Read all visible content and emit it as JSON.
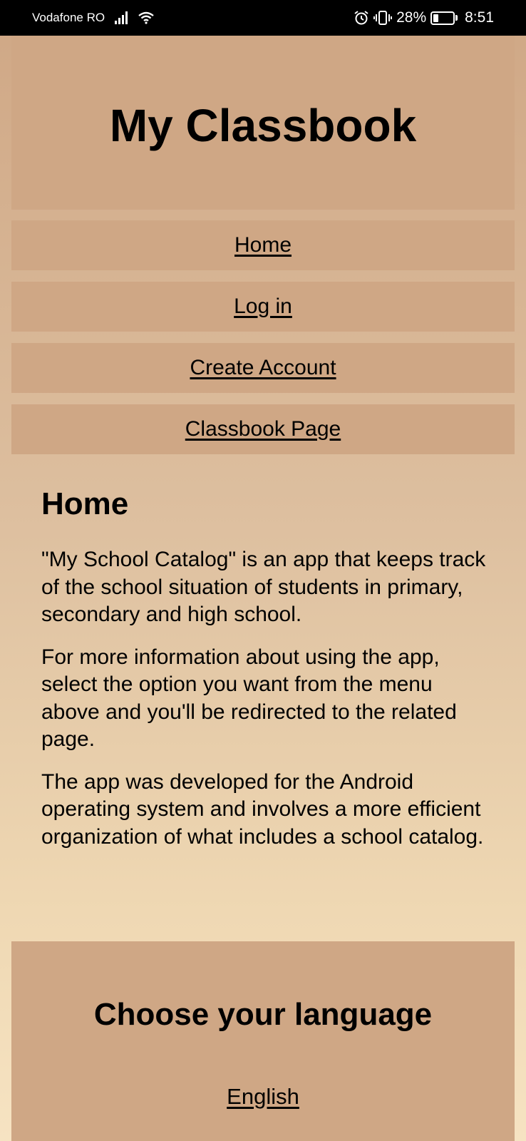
{
  "status_bar": {
    "carrier": "Vodafone RO",
    "battery_percent": "28%",
    "battery_level": 0.28,
    "time": "8:51",
    "icons": [
      "signal-icon",
      "wifi-icon",
      "alarm-icon",
      "vibrate-icon",
      "battery-icon"
    ]
  },
  "header": {
    "title": "My Classbook"
  },
  "nav": {
    "items": [
      {
        "label": "Home"
      },
      {
        "label": "Log in"
      },
      {
        "label": "Create Account"
      },
      {
        "label": "Classbook Page"
      }
    ]
  },
  "main": {
    "heading": "Home",
    "paragraphs": [
      "\"My School Catalog\" is an app that keeps track of the school situation of students in primary, secondary and high school.",
      "For more information about using the app, select the option you want from the menu above and you'll be redirected to the related page.",
      "The app was developed for the Android operating system and involves a more efficient organization of what includes a school catalog."
    ]
  },
  "language": {
    "title": "Choose your language",
    "options": [
      {
        "label": "English"
      }
    ]
  },
  "colors": {
    "panel": "#cfa785",
    "background_top": "#ddbf9f",
    "background_bottom": "#f6e3c2",
    "status_bar": "#000000"
  }
}
